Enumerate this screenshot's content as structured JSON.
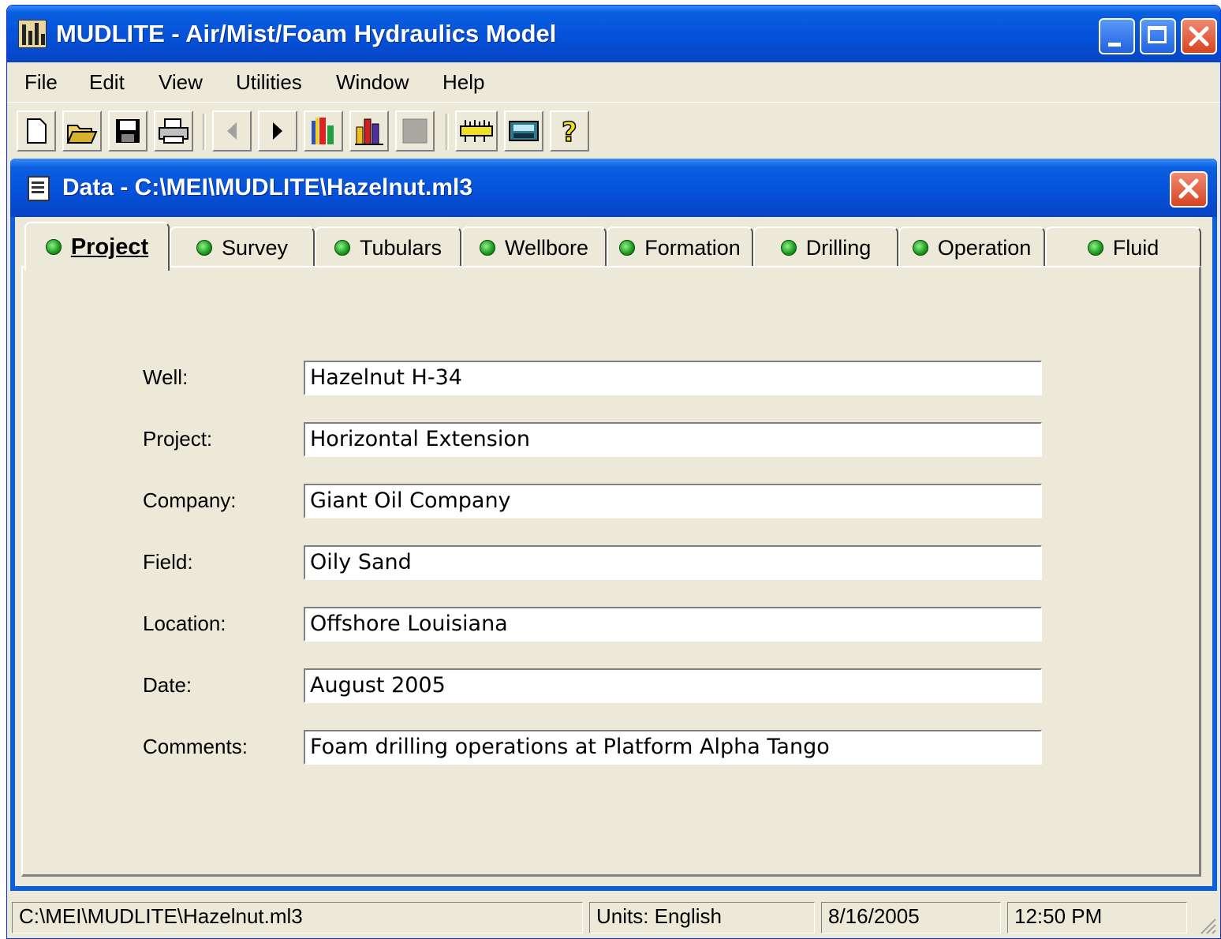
{
  "window": {
    "title": "MUDLITE - Air/Mist/Foam Hydraulics Model"
  },
  "menu": [
    "File",
    "Edit",
    "View",
    "Utilities",
    "Window",
    "Help"
  ],
  "child": {
    "title": "Data - C:\\MEI\\MUDLITE\\Hazelnut.ml3"
  },
  "tabs": [
    "Project",
    "Survey",
    "Tubulars",
    "Wellbore",
    "Formation",
    "Drilling",
    "Operation",
    "Fluid"
  ],
  "form": {
    "well_label": "Well:",
    "well": "Hazelnut H-34",
    "project_label": "Project:",
    "project": "Horizontal Extension",
    "company_label": "Company:",
    "company": "Giant Oil Company",
    "field_label": "Field:",
    "field": "Oily Sand",
    "location_label": "Location:",
    "location": "Offshore Louisiana",
    "date_label": "Date:",
    "date": "August 2005",
    "comments_label": "Comments:",
    "comments": "Foam drilling operations at Platform Alpha Tango"
  },
  "status": {
    "path": "C:\\MEI\\MUDLITE\\Hazelnut.ml3",
    "units": "Units: English",
    "date": "8/16/2005",
    "time": "12:50 PM"
  },
  "toolbar_icons": [
    "new-icon",
    "open-icon",
    "save-icon",
    "print-icon",
    "back-icon",
    "forward-icon",
    "chart-icon",
    "bar-chart-icon",
    "stop-icon",
    "ruler-icon",
    "calculator-icon",
    "help-icon"
  ],
  "colors": {
    "titlebar": "#0550d8",
    "face": "#ece9d8",
    "close": "#d84420",
    "status_dot": "#1a9a1a"
  }
}
